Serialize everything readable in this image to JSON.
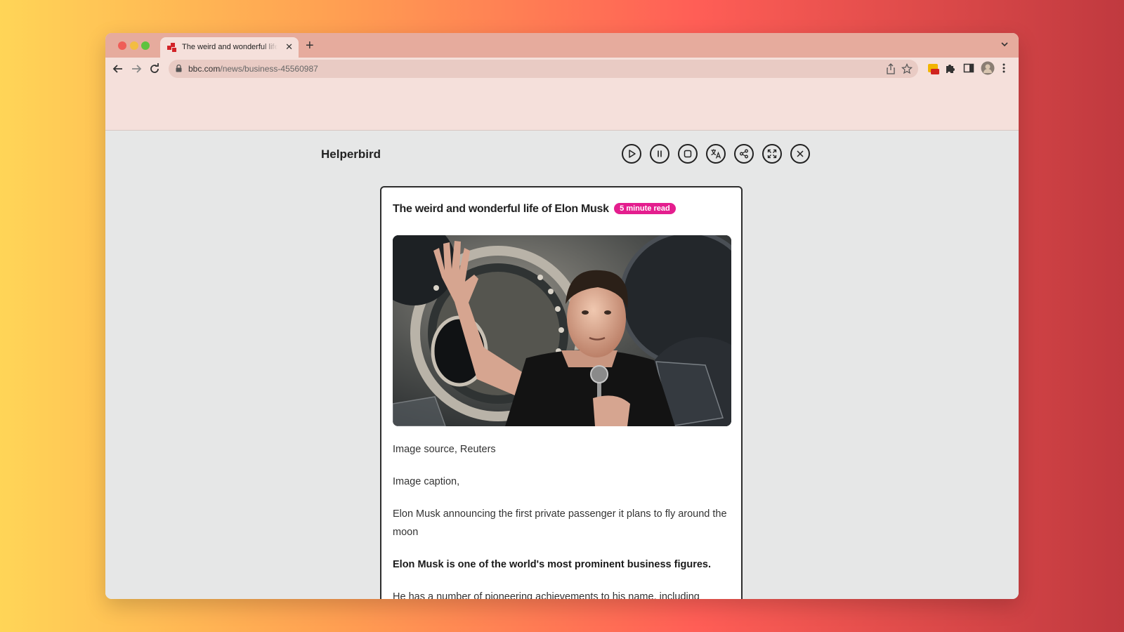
{
  "browser": {
    "tab_title": "The weird and wonderful life of Elon Musk",
    "tab_close": "✕",
    "new_tab": "+",
    "url_host": "bbc.com",
    "url_path": "/news/business-45560987"
  },
  "app": {
    "name": "Helperbird",
    "controls": [
      "play",
      "pause",
      "stop",
      "translate",
      "share",
      "fullscreen",
      "close"
    ]
  },
  "article": {
    "title": "The weird and wonderful life of Elon Musk",
    "read_time": "5 minute read",
    "image_source": "Image source, Reuters",
    "image_caption_label": "Image caption,",
    "caption": "Elon Musk announcing the first private passenger it plans to fly around the moon",
    "lead": "Elon Musk is one of the world's most prominent business figures.",
    "body": "He has a number of pioneering achievements to his name, including creating online payment platform PayPal, running electric car maker"
  },
  "colors": {
    "badge": "#e41e8e",
    "tabbar": "#e6ab9d",
    "toolbar": "#f5e0db"
  }
}
